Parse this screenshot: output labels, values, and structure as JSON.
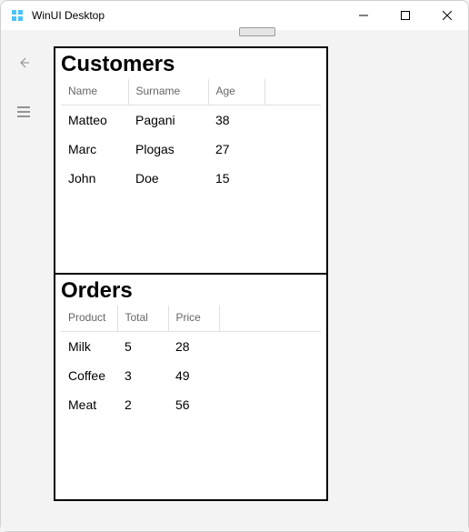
{
  "window": {
    "title": "WinUI Desktop"
  },
  "nav": {
    "back_icon": "back",
    "menu_icon": "hamburger"
  },
  "customers": {
    "heading": "Customers",
    "columns": {
      "name": "Name",
      "surname": "Surname",
      "age": "Age"
    },
    "rows": [
      {
        "name": "Matteo",
        "surname": "Pagani",
        "age": "38"
      },
      {
        "name": "Marc",
        "surname": "Plogas",
        "age": "27"
      },
      {
        "name": "John",
        "surname": "Doe",
        "age": "15"
      }
    ]
  },
  "orders": {
    "heading": "Orders",
    "columns": {
      "product": "Product",
      "total": "Total",
      "price": "Price"
    },
    "rows": [
      {
        "product": "Milk",
        "total": "5",
        "price": "28"
      },
      {
        "product": "Coffee",
        "total": "3",
        "price": "49"
      },
      {
        "product": "Meat",
        "total": "2",
        "price": "56"
      }
    ]
  }
}
